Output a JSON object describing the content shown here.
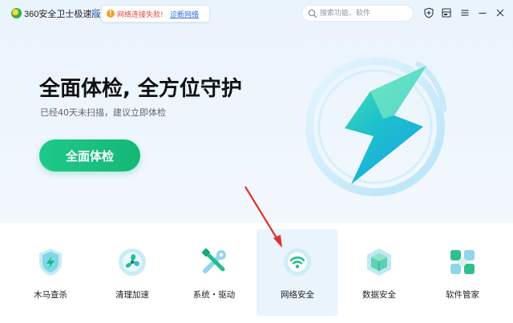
{
  "app": {
    "title": "360安全卫士极速版"
  },
  "network_warning": {
    "message": "网络连接失败!",
    "link_label": "诊断网络"
  },
  "search": {
    "placeholder": "搜索功能、软件"
  },
  "hero": {
    "title": "全面体检, 全方位守护",
    "subtitle": "已经40天未扫描，建议立即体检",
    "scan_button_label": "全面体检"
  },
  "tools": [
    {
      "label": "木马查杀",
      "icon": "shield-bolt-icon",
      "active": false
    },
    {
      "label": "清理加速",
      "icon": "fan-icon",
      "active": false
    },
    {
      "label": "系统・驱动",
      "icon": "wrench-screwdriver-icon",
      "active": false
    },
    {
      "label": "网络安全",
      "icon": "wifi-icon",
      "active": true
    },
    {
      "label": "数据安全",
      "icon": "cube-icon",
      "active": false
    },
    {
      "label": "软件管家",
      "icon": "apps-grid-icon",
      "active": false
    }
  ],
  "colors": {
    "accent_green": "#1ec98a",
    "warning_red": "#e24a3b",
    "link_blue": "#2c6fd8",
    "annotation_red": "#e0322a"
  }
}
